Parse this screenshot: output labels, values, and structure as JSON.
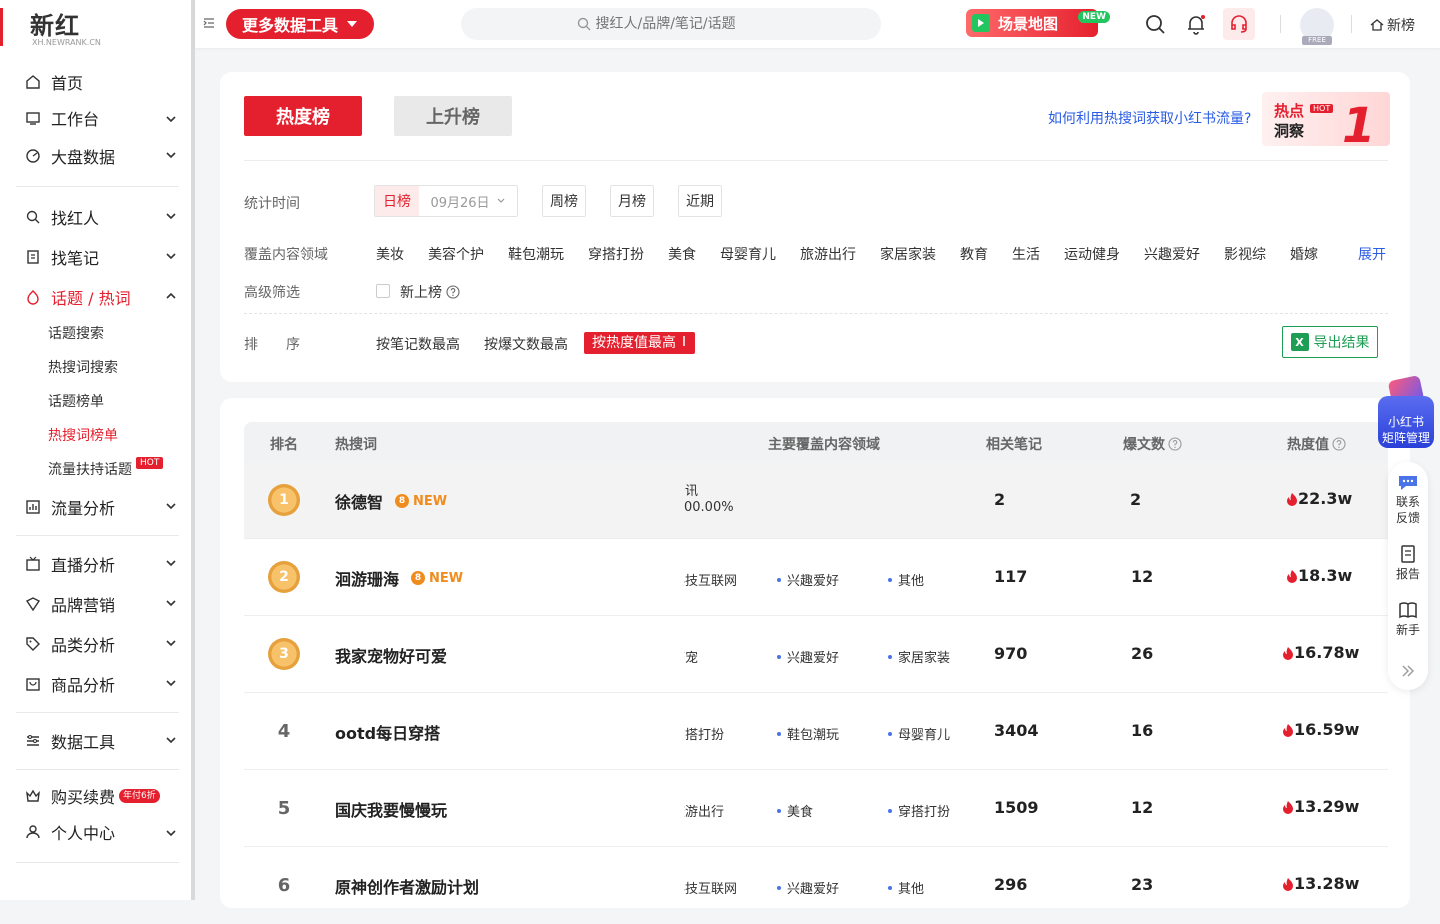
{
  "logo": {
    "brand": "新红",
    "sub": "XH.NEWRANK.CN"
  },
  "sidebar": {
    "items": [
      {
        "label": "首页",
        "icon": "home-icon"
      },
      {
        "label": "工作台",
        "icon": "workbench-icon"
      },
      {
        "label": "大盘数据",
        "icon": "dashboard-icon"
      },
      {
        "label": "找红人",
        "icon": "search-user-icon"
      },
      {
        "label": "找笔记",
        "icon": "note-icon"
      },
      {
        "label": "话题 / 热词",
        "icon": "topic-icon"
      },
      {
        "label": "流量分析",
        "icon": "traffic-icon"
      },
      {
        "label": "直播分析",
        "icon": "live-icon"
      },
      {
        "label": "品牌营销",
        "icon": "brand-icon"
      },
      {
        "label": "品类分析",
        "icon": "category-icon"
      },
      {
        "label": "商品分析",
        "icon": "goods-icon"
      },
      {
        "label": "数据工具",
        "icon": "tools-icon"
      },
      {
        "label": "购买续费",
        "icon": "buy-icon",
        "badge": "年付6折"
      },
      {
        "label": "个人中心",
        "icon": "user-icon"
      }
    ],
    "sub_items": [
      {
        "label": "话题搜索"
      },
      {
        "label": "热搜词搜索"
      },
      {
        "label": "话题榜单"
      },
      {
        "label": "热搜词榜单"
      },
      {
        "label": "流量扶持话题",
        "badge": "HOT"
      }
    ]
  },
  "header": {
    "tools_label": "更多数据工具",
    "search_placeholder": "搜红人/品牌/笔记/话题",
    "scene_label": "场景地图",
    "scene_badge": "NEW",
    "avatar_badge": "FREE",
    "brand_link": "新榜"
  },
  "filter": {
    "tab_hot": "热度榜",
    "tab_rise": "上升榜",
    "help_link": "如何利用热搜词获取小红书流量?",
    "banner_line1": "热点",
    "banner_tag": "HOT",
    "banner_line2": "洞察",
    "banner_digit": "1",
    "time_label": "统计时间",
    "day_label": "日榜",
    "date_value": "09月26日",
    "week_label": "周榜",
    "month_label": "月榜",
    "recent_label": "近期",
    "domain_label": "覆盖内容领域",
    "domains": [
      "美妆",
      "美容个护",
      "鞋包潮玩",
      "穿搭打扮",
      "美食",
      "母婴育儿",
      "旅游出行",
      "家居家装",
      "教育",
      "生活",
      "运动健身",
      "兴趣爱好",
      "影视综",
      "婚嫁"
    ],
    "expand_label": "展开",
    "advanced_label": "高级筛选",
    "new_label": "新上榜",
    "sort_label_1": "排",
    "sort_label_2": "序",
    "sort_notes": "按笔记数最高",
    "sort_viral": "按爆文数最高",
    "sort_heat": "按热度值最高",
    "export_label": "导出结果"
  },
  "table": {
    "headers": {
      "rank": "排名",
      "keyword": "热搜词",
      "domain": "主要覆盖内容领域",
      "notes": "相关笔记",
      "viral": "爆文数",
      "heat": "热度值"
    },
    "rows": [
      {
        "rank": "1",
        "keyword": "徐德智",
        "new": "NEW",
        "domains": [
          "资讯"
        ],
        "domain_pct": "00.00%",
        "notes": "2",
        "viral": "2",
        "heat": "22.3w"
      },
      {
        "rank": "2",
        "keyword": "洄游珊海",
        "new": "NEW",
        "domains": [
          "科技互联网",
          "兴趣爱好",
          "其他"
        ],
        "notes": "117",
        "viral": "12",
        "heat": "18.3w"
      },
      {
        "rank": "3",
        "keyword": "我家宠物好可爱",
        "domains": [
          "萌宠",
          "兴趣爱好",
          "家居家装"
        ],
        "notes": "970",
        "viral": "26",
        "heat": "16.78w"
      },
      {
        "rank": "4",
        "keyword": "ootd每日穿搭",
        "domains": [
          "穿搭打扮",
          "鞋包潮玩",
          "母婴育儿"
        ],
        "notes": "3404",
        "viral": "16",
        "heat": "16.59w"
      },
      {
        "rank": "5",
        "keyword": "国庆我要慢慢玩",
        "domains": [
          "旅游出行",
          "美食",
          "穿搭打扮"
        ],
        "notes": "1509",
        "viral": "12",
        "heat": "13.29w"
      },
      {
        "rank": "6",
        "keyword": "原神创作者激励计划",
        "domains": [
          "科技互联网",
          "兴趣爱好",
          "其他"
        ],
        "notes": "296",
        "viral": "23",
        "heat": "13.28w"
      }
    ]
  },
  "float": {
    "matrix_line1": "小红书",
    "matrix_line2": "矩阵管理",
    "contact_1": "联系",
    "contact_2": "反馈",
    "report": "报告",
    "newbie": "新手"
  },
  "colors": {
    "accent": "#e5202e",
    "link": "#2a5ce6",
    "excel": "#1e9e54"
  }
}
